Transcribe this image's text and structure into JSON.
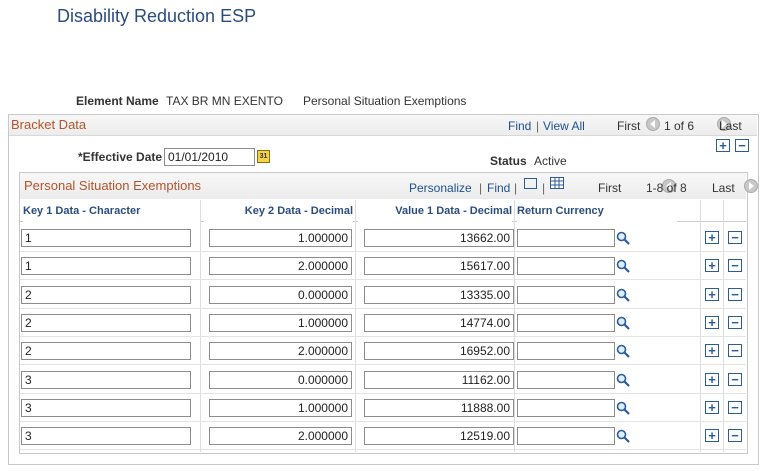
{
  "page_title": "Disability Reduction ESP",
  "element": {
    "label": "Element Name",
    "name": "TAX BR MN EXENTO",
    "description": "Personal Situation Exemptions"
  },
  "bracket": {
    "title": "Bracket Data",
    "find": "Find",
    "view_all": "View All",
    "first": "First",
    "count": "1 of 6",
    "last": "Last",
    "effective_date_label": "*Effective Date",
    "effective_date_value": "01/01/2010",
    "status_label": "Status",
    "status_value": "Active"
  },
  "grid": {
    "title": "Personal Situation Exemptions",
    "personalize": "Personalize",
    "find": "Find",
    "first": "First",
    "count": "1-8 of 8",
    "last": "Last",
    "columns": [
      "Key 1 Data - Character",
      "Key 2 Data - Decimal",
      "Value 1 Data - Decimal",
      "Return Currency"
    ],
    "rows": [
      {
        "key1": "1",
        "key2": "1.000000",
        "value1": "13662.00",
        "currency": ""
      },
      {
        "key1": "1",
        "key2": "2.000000",
        "value1": "15617.00",
        "currency": ""
      },
      {
        "key1": "2",
        "key2": "0.000000",
        "value1": "13335.00",
        "currency": ""
      },
      {
        "key1": "2",
        "key2": "1.000000",
        "value1": "14774.00",
        "currency": ""
      },
      {
        "key1": "2",
        "key2": "2.000000",
        "value1": "16952.00",
        "currency": ""
      },
      {
        "key1": "3",
        "key2": "0.000000",
        "value1": "11162.00",
        "currency": ""
      },
      {
        "key1": "3",
        "key2": "1.000000",
        "value1": "11888.00",
        "currency": ""
      },
      {
        "key1": "3",
        "key2": "2.000000",
        "value1": "12519.00",
        "currency": ""
      }
    ]
  },
  "icons": {
    "add": "+",
    "remove": "−",
    "calendar": "31"
  },
  "colors": {
    "title": "#2a4d7d",
    "section_title": "#b1542c",
    "link": "#1f4f8f"
  }
}
